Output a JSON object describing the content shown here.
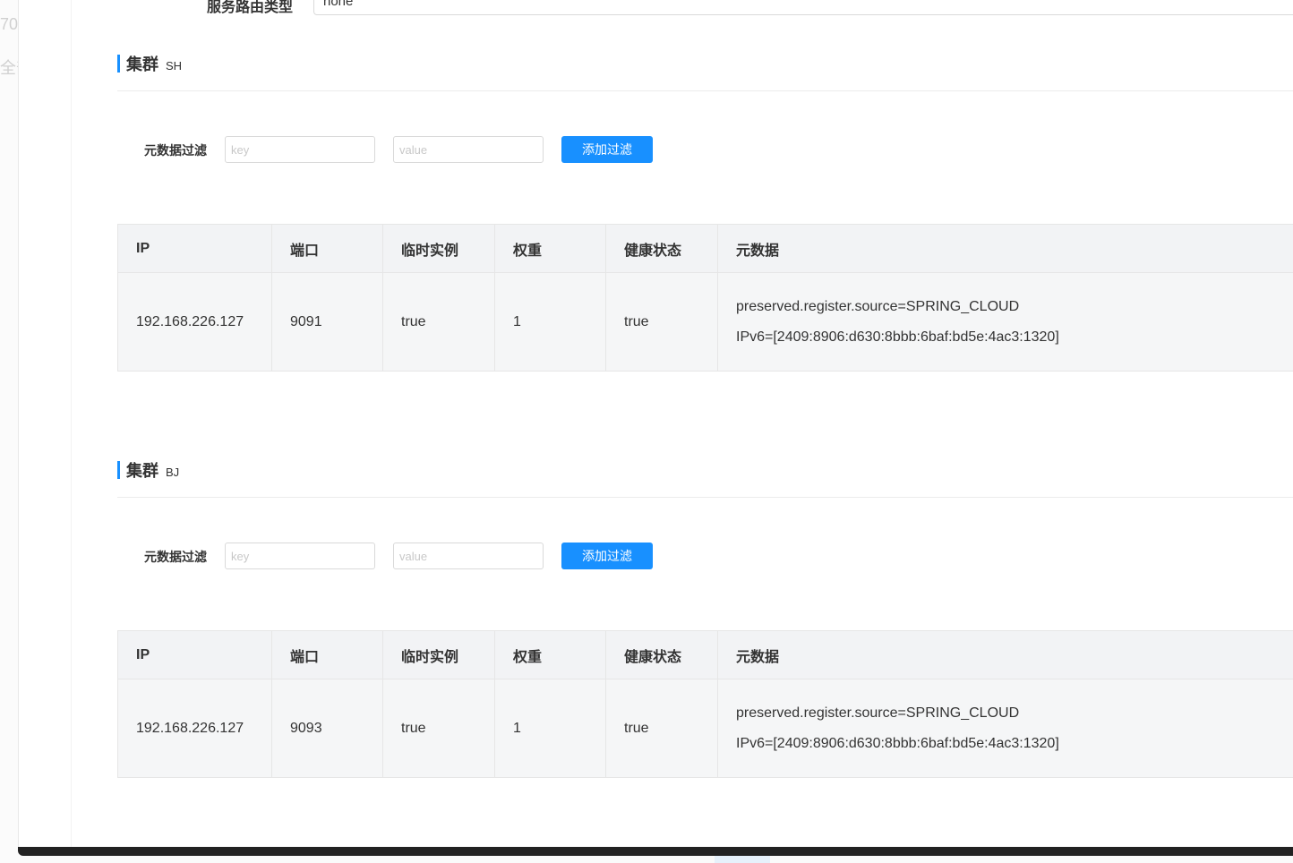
{
  "background": {
    "left_fragments": [
      "70",
      "全部"
    ]
  },
  "top_field": {
    "label": "服务路由类型",
    "value": "none"
  },
  "columns": [
    "IP",
    "端口",
    "临时实例",
    "权重",
    "健康状态",
    "元数据"
  ],
  "clusters": [
    {
      "title": "集群",
      "name": "SH",
      "filter": {
        "label": "元数据过滤",
        "key_placeholder": "key",
        "value_placeholder": "value",
        "button_label": "添加过滤"
      },
      "rows": [
        {
          "ip": "192.168.226.127",
          "port": "9091",
          "ephemeral": "true",
          "weight": "1",
          "healthy": "true",
          "metadata": [
            "preserved.register.source=SPRING_CLOUD",
            "IPv6=[2409:8906:d630:8bbb:6baf:bd5e:4ac3:1320]"
          ]
        }
      ]
    },
    {
      "title": "集群",
      "name": "BJ",
      "filter": {
        "label": "元数据过滤",
        "key_placeholder": "key",
        "value_placeholder": "value",
        "button_label": "添加过滤"
      },
      "rows": [
        {
          "ip": "192.168.226.127",
          "port": "9093",
          "ephemeral": "true",
          "weight": "1",
          "healthy": "true",
          "metadata": [
            "preserved.register.source=SPRING_CLOUD",
            "IPv6=[2409:8906:d630:8bbb:6baf:bd5e:4ac3:1320]"
          ]
        }
      ]
    }
  ]
}
